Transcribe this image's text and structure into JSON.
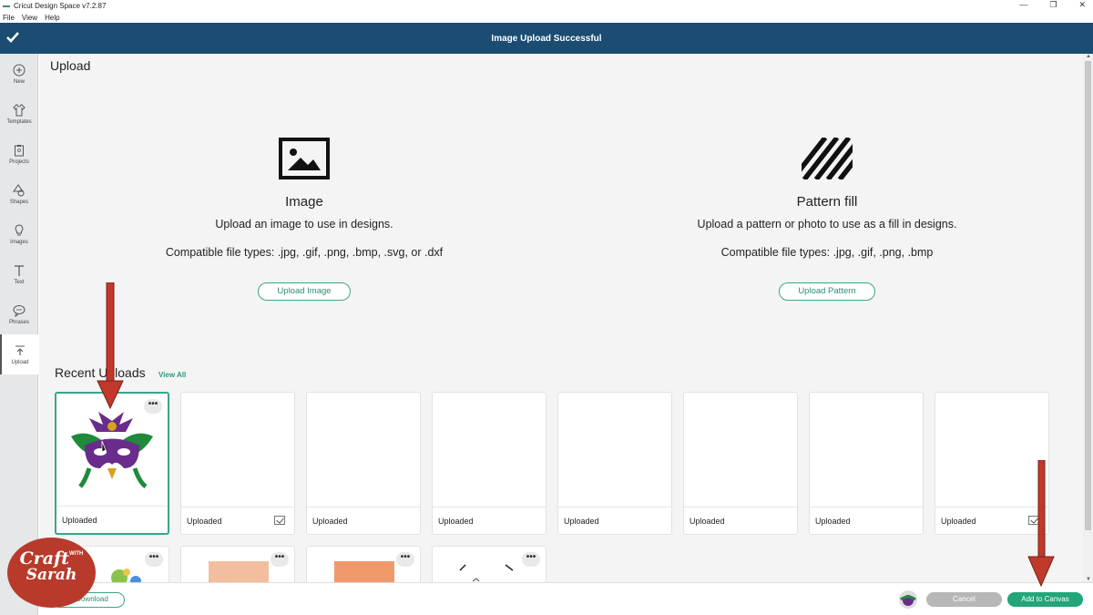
{
  "window": {
    "title": "Cricut Design Space  v7.2.87",
    "controls": [
      "—",
      "❐",
      "✕"
    ]
  },
  "menu": [
    "File",
    "View",
    "Help"
  ],
  "topbar": {
    "status": "Image Upload Successful"
  },
  "sidebar": {
    "items": [
      {
        "label": "New",
        "icon": "plus-circle-icon"
      },
      {
        "label": "Templates",
        "icon": "shirt-icon"
      },
      {
        "label": "Projects",
        "icon": "clipboard-icon"
      },
      {
        "label": "Shapes",
        "icon": "shapes-icon"
      },
      {
        "label": "Images",
        "icon": "lightbulb-icon"
      },
      {
        "label": "Text",
        "icon": "text-icon"
      },
      {
        "label": "Phrases",
        "icon": "speech-bubble-icon"
      },
      {
        "label": "Upload",
        "icon": "upload-icon",
        "active": true
      }
    ]
  },
  "main": {
    "title": "Upload",
    "image_panel": {
      "heading": "Image",
      "description": "Upload an image to use in designs.",
      "types": "Compatible file types: .jpg, .gif, .png, .bmp, .svg, or .dxf",
      "button": "Upload Image"
    },
    "pattern_panel": {
      "heading": "Pattern fill",
      "description": "Upload a pattern or photo to use as a fill in designs.",
      "types": "Compatible file types: .jpg, .gif, .png, .bmp",
      "button": "Upload Pattern"
    },
    "recent": {
      "title": "Recent Uploads",
      "view_all": "View All",
      "cards": [
        {
          "label": "Uploaded",
          "selected": true,
          "thumb": "mardi-gras-mask"
        },
        {
          "label": "Uploaded",
          "checkbox": true
        },
        {
          "label": "Uploaded"
        },
        {
          "label": "Uploaded"
        },
        {
          "label": "Uploaded"
        },
        {
          "label": "Uploaded"
        },
        {
          "label": "Uploaded"
        },
        {
          "label": "Uploaded",
          "checkbox": true
        }
      ],
      "more": "•••"
    }
  },
  "bottom": {
    "download": "Download",
    "cancel": "Cancel",
    "add": "Add to Canvas"
  },
  "watermark": {
    "line1": "Craft",
    "with": "WITH",
    "line2": "Sarah"
  },
  "colors": {
    "brand": "#1b4c72",
    "accent": "#22a578",
    "arrow": "#c0392b"
  }
}
